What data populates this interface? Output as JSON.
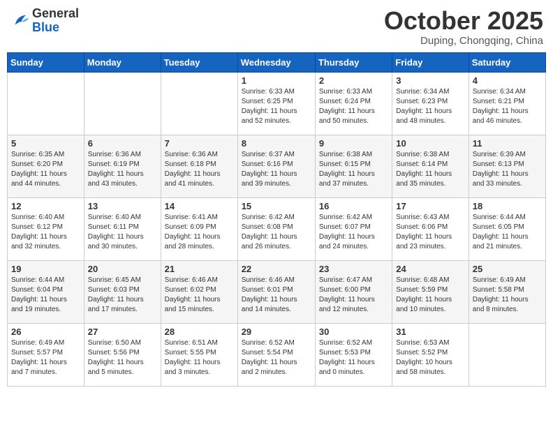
{
  "header": {
    "logo_general": "General",
    "logo_blue": "Blue",
    "month": "October 2025",
    "location": "Duping, Chongqing, China"
  },
  "days_of_week": [
    "Sunday",
    "Monday",
    "Tuesday",
    "Wednesday",
    "Thursday",
    "Friday",
    "Saturday"
  ],
  "weeks": [
    [
      {
        "day": "",
        "info": ""
      },
      {
        "day": "",
        "info": ""
      },
      {
        "day": "",
        "info": ""
      },
      {
        "day": "1",
        "info": "Sunrise: 6:33 AM\nSunset: 6:25 PM\nDaylight: 11 hours\nand 52 minutes."
      },
      {
        "day": "2",
        "info": "Sunrise: 6:33 AM\nSunset: 6:24 PM\nDaylight: 11 hours\nand 50 minutes."
      },
      {
        "day": "3",
        "info": "Sunrise: 6:34 AM\nSunset: 6:23 PM\nDaylight: 11 hours\nand 48 minutes."
      },
      {
        "day": "4",
        "info": "Sunrise: 6:34 AM\nSunset: 6:21 PM\nDaylight: 11 hours\nand 46 minutes."
      }
    ],
    [
      {
        "day": "5",
        "info": "Sunrise: 6:35 AM\nSunset: 6:20 PM\nDaylight: 11 hours\nand 44 minutes."
      },
      {
        "day": "6",
        "info": "Sunrise: 6:36 AM\nSunset: 6:19 PM\nDaylight: 11 hours\nand 43 minutes."
      },
      {
        "day": "7",
        "info": "Sunrise: 6:36 AM\nSunset: 6:18 PM\nDaylight: 11 hours\nand 41 minutes."
      },
      {
        "day": "8",
        "info": "Sunrise: 6:37 AM\nSunset: 6:16 PM\nDaylight: 11 hours\nand 39 minutes."
      },
      {
        "day": "9",
        "info": "Sunrise: 6:38 AM\nSunset: 6:15 PM\nDaylight: 11 hours\nand 37 minutes."
      },
      {
        "day": "10",
        "info": "Sunrise: 6:38 AM\nSunset: 6:14 PM\nDaylight: 11 hours\nand 35 minutes."
      },
      {
        "day": "11",
        "info": "Sunrise: 6:39 AM\nSunset: 6:13 PM\nDaylight: 11 hours\nand 33 minutes."
      }
    ],
    [
      {
        "day": "12",
        "info": "Sunrise: 6:40 AM\nSunset: 6:12 PM\nDaylight: 11 hours\nand 32 minutes."
      },
      {
        "day": "13",
        "info": "Sunrise: 6:40 AM\nSunset: 6:11 PM\nDaylight: 11 hours\nand 30 minutes."
      },
      {
        "day": "14",
        "info": "Sunrise: 6:41 AM\nSunset: 6:09 PM\nDaylight: 11 hours\nand 28 minutes."
      },
      {
        "day": "15",
        "info": "Sunrise: 6:42 AM\nSunset: 6:08 PM\nDaylight: 11 hours\nand 26 minutes."
      },
      {
        "day": "16",
        "info": "Sunrise: 6:42 AM\nSunset: 6:07 PM\nDaylight: 11 hours\nand 24 minutes."
      },
      {
        "day": "17",
        "info": "Sunrise: 6:43 AM\nSunset: 6:06 PM\nDaylight: 11 hours\nand 23 minutes."
      },
      {
        "day": "18",
        "info": "Sunrise: 6:44 AM\nSunset: 6:05 PM\nDaylight: 11 hours\nand 21 minutes."
      }
    ],
    [
      {
        "day": "19",
        "info": "Sunrise: 6:44 AM\nSunset: 6:04 PM\nDaylight: 11 hours\nand 19 minutes."
      },
      {
        "day": "20",
        "info": "Sunrise: 6:45 AM\nSunset: 6:03 PM\nDaylight: 11 hours\nand 17 minutes."
      },
      {
        "day": "21",
        "info": "Sunrise: 6:46 AM\nSunset: 6:02 PM\nDaylight: 11 hours\nand 15 minutes."
      },
      {
        "day": "22",
        "info": "Sunrise: 6:46 AM\nSunset: 6:01 PM\nDaylight: 11 hours\nand 14 minutes."
      },
      {
        "day": "23",
        "info": "Sunrise: 6:47 AM\nSunset: 6:00 PM\nDaylight: 11 hours\nand 12 minutes."
      },
      {
        "day": "24",
        "info": "Sunrise: 6:48 AM\nSunset: 5:59 PM\nDaylight: 11 hours\nand 10 minutes."
      },
      {
        "day": "25",
        "info": "Sunrise: 6:49 AM\nSunset: 5:58 PM\nDaylight: 11 hours\nand 8 minutes."
      }
    ],
    [
      {
        "day": "26",
        "info": "Sunrise: 6:49 AM\nSunset: 5:57 PM\nDaylight: 11 hours\nand 7 minutes."
      },
      {
        "day": "27",
        "info": "Sunrise: 6:50 AM\nSunset: 5:56 PM\nDaylight: 11 hours\nand 5 minutes."
      },
      {
        "day": "28",
        "info": "Sunrise: 6:51 AM\nSunset: 5:55 PM\nDaylight: 11 hours\nand 3 minutes."
      },
      {
        "day": "29",
        "info": "Sunrise: 6:52 AM\nSunset: 5:54 PM\nDaylight: 11 hours\nand 2 minutes."
      },
      {
        "day": "30",
        "info": "Sunrise: 6:52 AM\nSunset: 5:53 PM\nDaylight: 11 hours\nand 0 minutes."
      },
      {
        "day": "31",
        "info": "Sunrise: 6:53 AM\nSunset: 5:52 PM\nDaylight: 10 hours\nand 58 minutes."
      },
      {
        "day": "",
        "info": ""
      }
    ]
  ]
}
